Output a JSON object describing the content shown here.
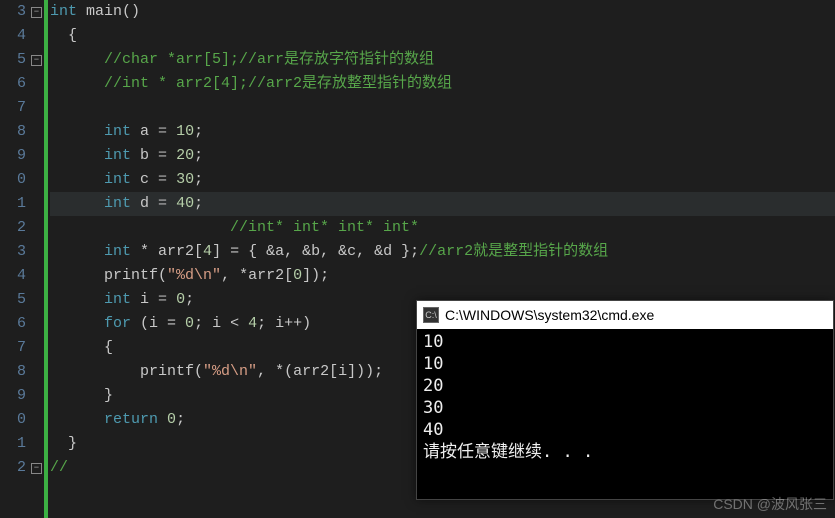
{
  "gutter": [
    "3",
    "4",
    "5",
    "6",
    "7",
    "8",
    "9",
    "0",
    "1",
    "2",
    "3",
    "4",
    "5",
    "6",
    "7",
    "8",
    "9",
    "0",
    "1",
    "2"
  ],
  "code": {
    "l0": {
      "kw1": "int",
      "fn": " main",
      "p": "()"
    },
    "l1": {
      "brace": "{"
    },
    "l2": {
      "c": "//char *arr[5];//arr是存放字符指针的数组"
    },
    "l3": {
      "c": "//int * arr2[4];//arr2是存放整型指针的数组"
    },
    "l4": "",
    "l5": {
      "kw": "int",
      "sp": " a ",
      "eq": "=",
      "sp2": " ",
      "num": "10",
      "semi": ";"
    },
    "l6": {
      "kw": "int",
      "sp": " b ",
      "eq": "=",
      "sp2": " ",
      "num": "20",
      "semi": ";"
    },
    "l7": {
      "kw": "int",
      "sp": " c ",
      "eq": "=",
      "sp2": " ",
      "num": "30",
      "semi": ";"
    },
    "l8": {
      "kw": "int",
      "sp": " d ",
      "eq": "=",
      "sp2": " ",
      "num": "40",
      "semi": ";"
    },
    "l9": {
      "c": "//int* int* int* int*"
    },
    "l10": {
      "kw": "int",
      "rest": " * arr2[",
      "n": "4",
      "r2": "] = { &a, &b, &c, &d };",
      "c": "//arr2就是整型指针的数组"
    },
    "l11": {
      "f": "printf",
      "p1": "(",
      "s": "\"%d\\n\"",
      "m": ", *arr2[",
      "n": "0",
      "e": "]);"
    },
    "l12": {
      "kw": "int",
      "sp": " i ",
      "eq": "=",
      "sp2": " ",
      "num": "0",
      "semi": ";"
    },
    "l13": {
      "kw": "for",
      "p": " (i = ",
      "n0": "0",
      "m": "; i < ",
      "n1": "4",
      "e": "; i++)"
    },
    "l14": {
      "brace": "{"
    },
    "l15": {
      "f": "printf",
      "p1": "(",
      "s": "\"%d\\n\"",
      "m": ", *(arr2[i]));"
    },
    "l16": {
      "brace": "}"
    },
    "l17": {
      "kw": "return",
      "sp": " ",
      "num": "0",
      "semi": ";"
    },
    "l18": {
      "brace": "}"
    },
    "l19": {
      "c": "//"
    }
  },
  "console": {
    "title": "C:\\WINDOWS\\system32\\cmd.exe",
    "icon": "C:\\",
    "out": [
      "10",
      "10",
      "20",
      "30",
      "40",
      "请按任意键继续. . ."
    ]
  },
  "watermark": "CSDN @波风张三"
}
